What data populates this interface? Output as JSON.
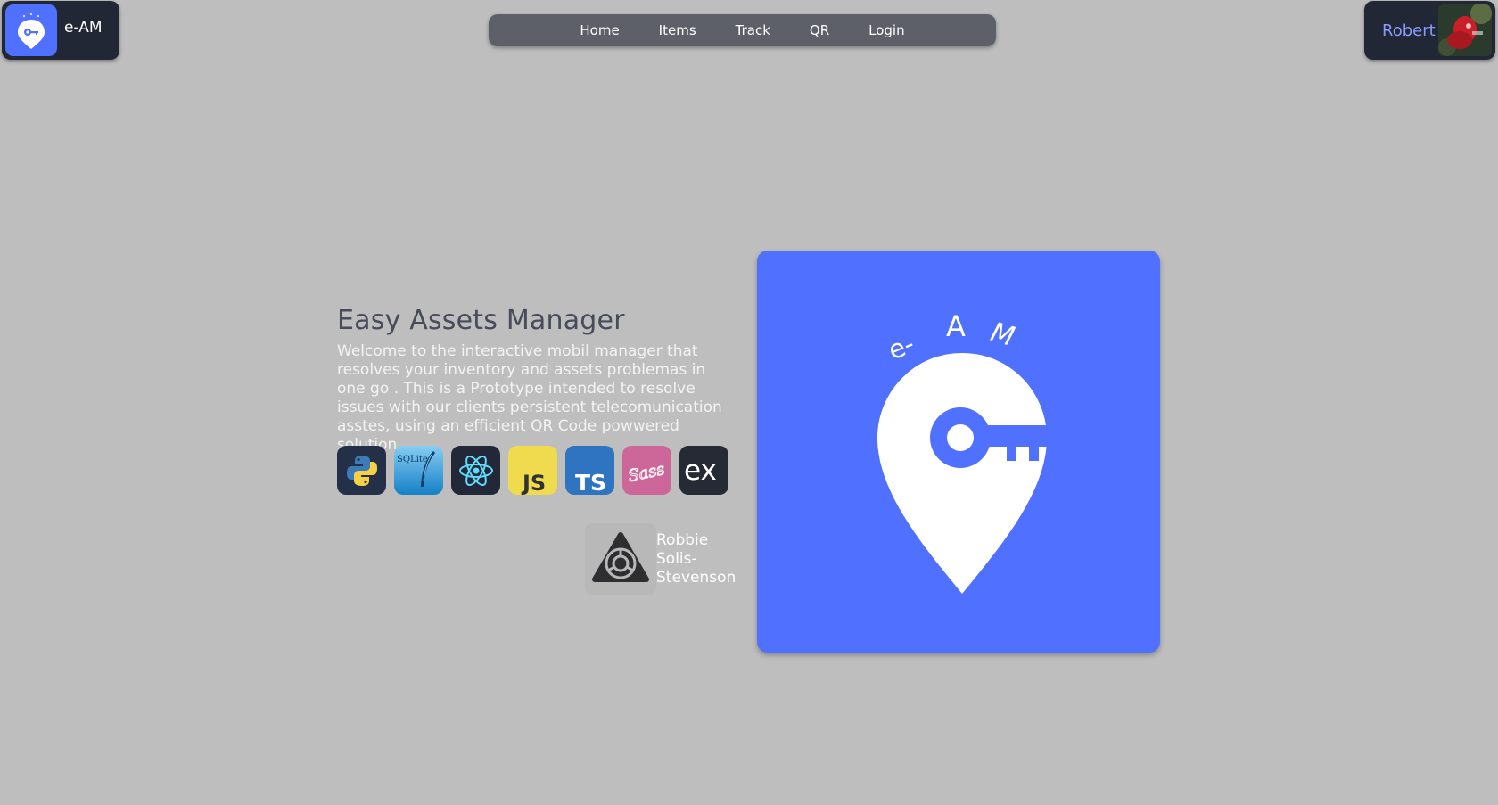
{
  "brand": {
    "name": "e-AM"
  },
  "nav": {
    "items": [
      "Home",
      "Items",
      "Track",
      "QR",
      "Login"
    ]
  },
  "user": {
    "name": "Robert"
  },
  "hero": {
    "title": "Easy Assets Manager",
    "description": "Welcome to the interactive mobil manager that resolves your inventory and assets problemas in one go . This is a Prototype intended to resolve issues with our clients persistent telecomunication asstes, using an efficient QR Code powwered solution.",
    "logo_text": [
      "e-",
      "A",
      "M"
    ]
  },
  "tech_stack": [
    {
      "icon": "python-icon",
      "label": ""
    },
    {
      "icon": "sqlite-icon",
      "label": "SQLite"
    },
    {
      "icon": "react-icon",
      "label": ""
    },
    {
      "icon": "javascript-icon",
      "label": "JS"
    },
    {
      "icon": "typescript-icon",
      "label": "TS"
    },
    {
      "icon": "sass-icon",
      "label": "Sass"
    },
    {
      "icon": "express-icon",
      "label": "ex"
    }
  ],
  "author": {
    "name": "Robbie Solis-Stevenson"
  },
  "colors": {
    "background": "#bebebe",
    "panel": "#222736",
    "nav": "#5e6069",
    "accent": "#5070ff",
    "user_name": "#8a9bff"
  }
}
